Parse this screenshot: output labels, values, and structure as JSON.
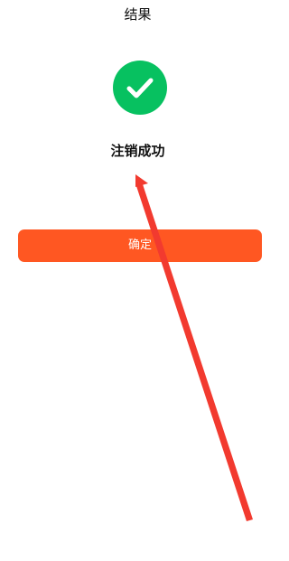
{
  "header": {
    "title": "结果"
  },
  "result": {
    "icon": "check-circle-icon",
    "status_text": "注销成功"
  },
  "actions": {
    "confirm_label": "确定"
  },
  "colors": {
    "success_green": "#07c160",
    "primary_orange": "#ff5722",
    "annotation_red": "#f23a2f"
  }
}
